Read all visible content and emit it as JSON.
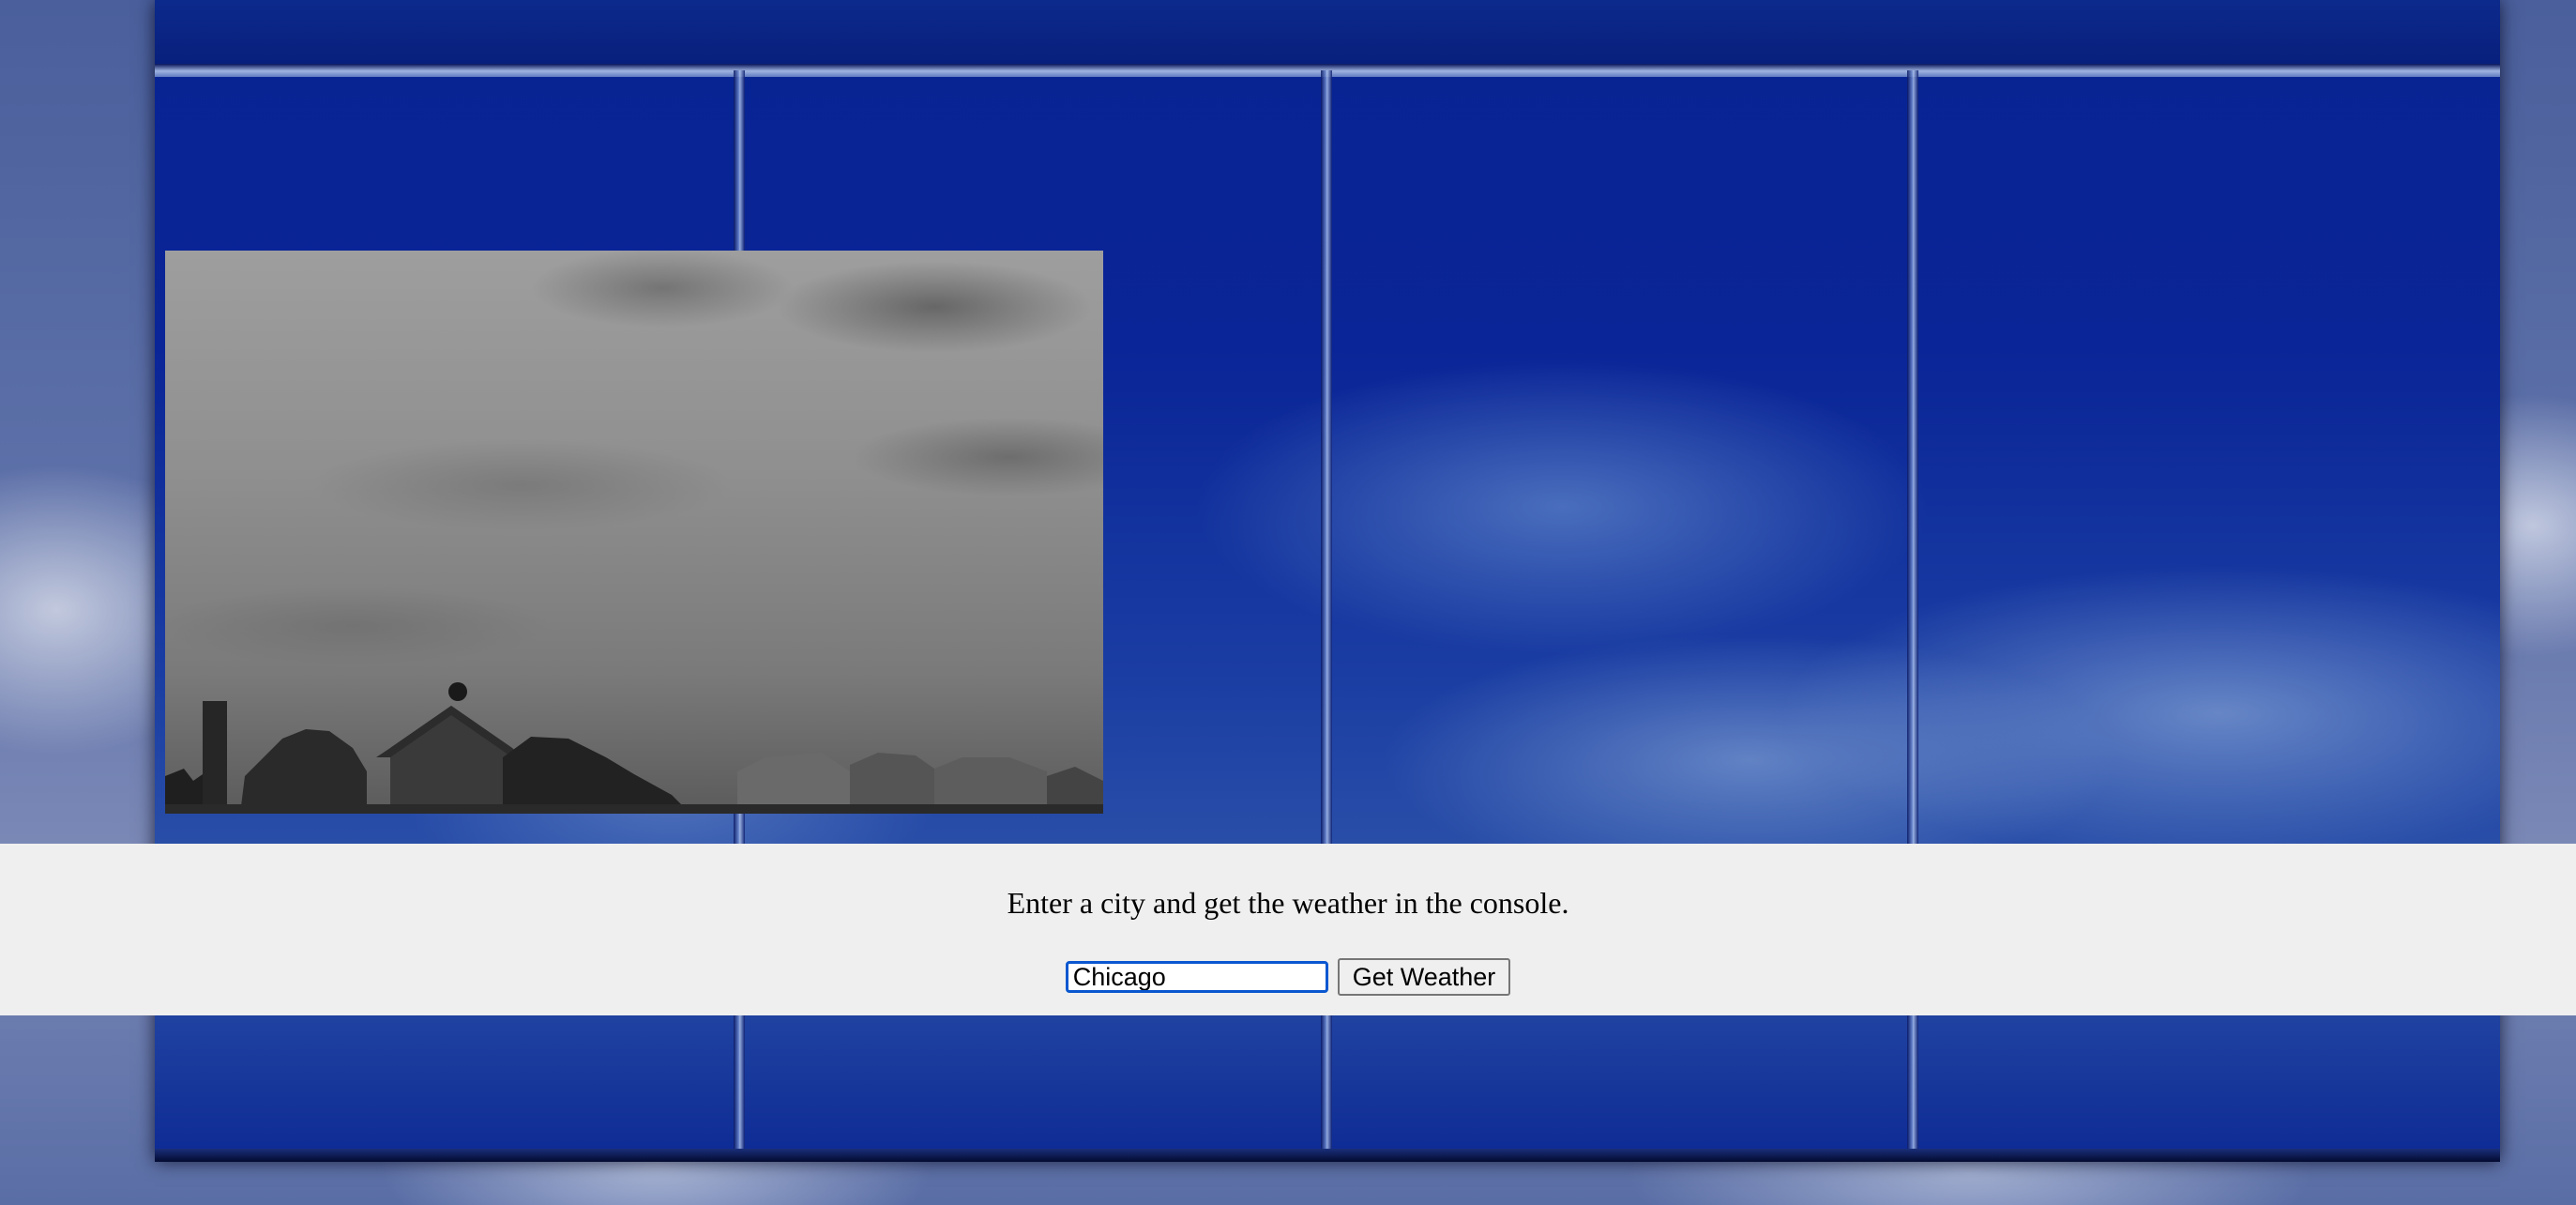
{
  "form": {
    "instruction": "Enter a city and get the weather in the console.",
    "city_input_value": "Chicago",
    "submit_label": "Get Weather"
  }
}
